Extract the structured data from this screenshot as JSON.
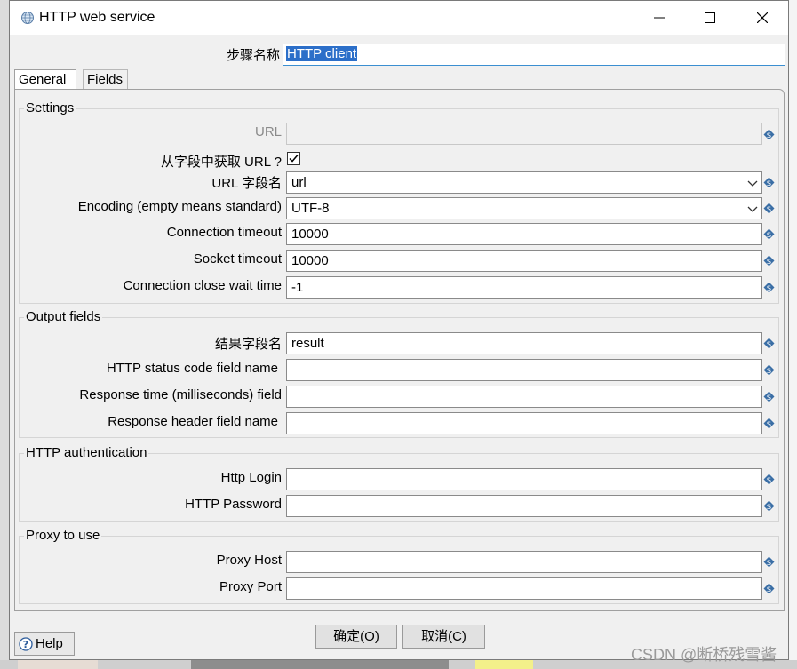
{
  "window": {
    "title": "HTTP web service",
    "step_name_label": "步骤名称",
    "step_name_value": "HTTP client"
  },
  "tabs": [
    {
      "label": "General",
      "active": true
    },
    {
      "label": "Fields",
      "active": false
    }
  ],
  "settings": {
    "group_title": "Settings",
    "url_label": "URL",
    "url_value": "",
    "url_from_field_label": "从字段中获取 URL ?",
    "url_from_field_checked": true,
    "url_field_name_label": "URL 字段名",
    "url_field_name_value": "url",
    "encoding_label": "Encoding (empty means standard)",
    "encoding_value": "UTF-8",
    "connection_timeout_label": "Connection timeout",
    "connection_timeout_value": "10000",
    "socket_timeout_label": "Socket timeout",
    "socket_timeout_value": "10000",
    "close_wait_label": "Connection close wait time",
    "close_wait_value": "-1"
  },
  "output_fields": {
    "group_title": "Output fields",
    "result_field_label": "结果字段名",
    "result_field_value": "result",
    "status_code_label": "HTTP status code field name",
    "status_code_value": "",
    "response_time_label": "Response time (milliseconds) field",
    "response_time_value": "",
    "response_header_label": "Response header field name",
    "response_header_value": ""
  },
  "http_auth": {
    "group_title": "HTTP authentication",
    "login_label": "Http Login",
    "login_value": "",
    "password_label": "HTTP Password",
    "password_value": ""
  },
  "proxy": {
    "group_title": "Proxy to use",
    "host_label": "Proxy Host",
    "host_value": "",
    "port_label": "Proxy Port",
    "port_value": ""
  },
  "buttons": {
    "ok": "确定(O)",
    "cancel": "取消(C)",
    "help": "Help"
  },
  "watermark": "CSDN @断桥残雪酱",
  "colors": {
    "selection": "#2c6fc9",
    "variable_icon": "#3a6ea5"
  },
  "icons": [
    "globe-icon",
    "minimize-icon",
    "maximize-icon",
    "close-icon",
    "variable-icon",
    "chevron-down-icon",
    "check-icon",
    "help-icon"
  ]
}
